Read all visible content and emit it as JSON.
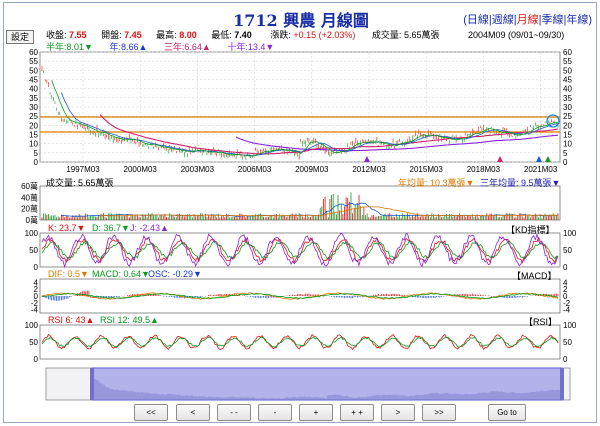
{
  "title": "1712 興農  月線圖",
  "periods": [
    {
      "label": "日線",
      "active": false
    },
    {
      "label": "週線",
      "active": false
    },
    {
      "label": "月線",
      "active": true
    },
    {
      "label": "季線",
      "active": false
    },
    {
      "label": "年線",
      "active": false
    }
  ],
  "setting_label": "設定",
  "quote": {
    "close_label": "收盤:",
    "close": "7.55",
    "open_label": "開盤:",
    "open": "7.45",
    "high_label": "最高:",
    "high": "8.00",
    "low_label": "最低:",
    "low": "7.40",
    "change_label": "漲跌:",
    "change": "+0.15 (+2.03%)",
    "volume_label": "成交量:",
    "volume": "5.65萬張",
    "period": "2004M09 (09/01~09/30)"
  },
  "ma": {
    "half_year": "半年:8.01▼",
    "one_year": "年:8.66▲",
    "three_year": "三年:6.64▲",
    "ten_year": "十年:13.4▼"
  },
  "price_axis": {
    "ticks": [
      "60",
      "55",
      "50",
      "45",
      "40",
      "35",
      "30",
      "25",
      "20",
      "15",
      "10",
      "5",
      "0"
    ],
    "x_labels": [
      "1997M03",
      "2000M03",
      "2003M03",
      "2006M03",
      "2009M03",
      "2012M03",
      "2015M03",
      "2018M03",
      "2021M03"
    ]
  },
  "volume_panel": {
    "label": "成交量: 5.65萬張",
    "year_avg": "年均量: 10.3萬張▼",
    "three_year_avg": "三年均量: 9.5萬張▼",
    "ticks": [
      "60萬",
      "40萬",
      "20萬",
      "0萬"
    ]
  },
  "kd_panel": {
    "k": "K: 23.7▼",
    "d": "D: 36.7▼",
    "j": "J: -2.43▲",
    "tag": "【KD指標】",
    "ticks": [
      "100",
      "50",
      "0"
    ]
  },
  "macd_panel": {
    "dif": "DIF: 0.5▼",
    "macd": "MACD: 0.64▼",
    "osc": "OSC: -0.29▼",
    "tag": "【MACD】",
    "ticks": [
      "4",
      "2",
      "0",
      "-2",
      "-4"
    ]
  },
  "rsi_panel": {
    "rsi6": "RSI 6: 43▲",
    "rsi12": "RSI 12: 49.5▲",
    "tag": "【RSI】",
    "ticks": [
      "100",
      "50",
      "0"
    ]
  },
  "nav": {
    "first": "<<",
    "prev": "<",
    "zoom_out_more": "- -",
    "zoom_out": "-",
    "zoom_in": "+",
    "zoom_in_more": "+ +",
    "next": ">",
    "last": ">>",
    "goto": "Go to"
  },
  "colors": {
    "candle_up": "#e01010",
    "candle_down": "#0a9a20",
    "half_year_ma": "#0a9a20",
    "year_ma": "#1a5ad0",
    "three_year_ma": "#d0206a",
    "ten_year_ma": "#8a24d8",
    "support_line": "#e07a00"
  }
}
